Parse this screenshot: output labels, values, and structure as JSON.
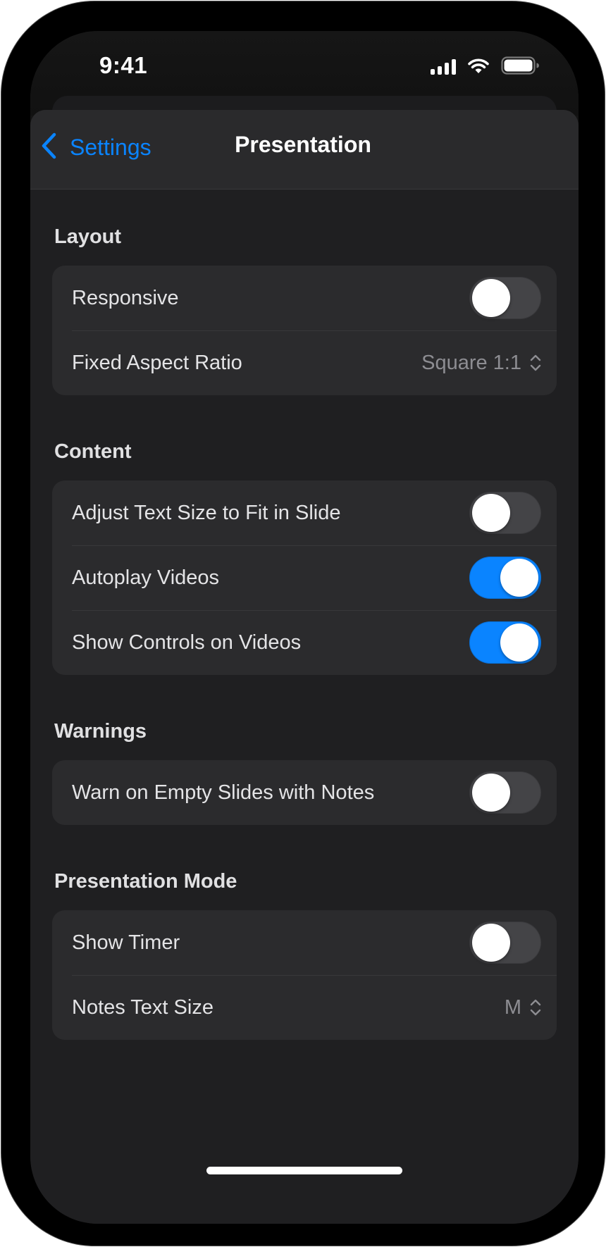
{
  "status_bar": {
    "time": "9:41",
    "icons": [
      "cellular-signal-icon",
      "wifi-icon",
      "battery-icon"
    ]
  },
  "nav": {
    "back_label": "Settings",
    "back_icon": "chevron-left-icon",
    "title": "Presentation"
  },
  "colors": {
    "accent": "#0a84ff",
    "background": "#1f1f21",
    "group_background": "#2b2b2d",
    "toggle_off": "#444447"
  },
  "sections": [
    {
      "header": "Layout",
      "rows": [
        {
          "label": "Responsive",
          "type": "toggle",
          "on": false
        },
        {
          "label": "Fixed Aspect Ratio",
          "type": "picker",
          "value": "Square 1:1"
        }
      ]
    },
    {
      "header": "Content",
      "rows": [
        {
          "label": "Adjust Text Size to Fit in Slide",
          "type": "toggle",
          "on": false
        },
        {
          "label": "Autoplay Videos",
          "type": "toggle",
          "on": true
        },
        {
          "label": "Show Controls on Videos",
          "type": "toggle",
          "on": true
        }
      ]
    },
    {
      "header": "Warnings",
      "rows": [
        {
          "label": "Warn on Empty Slides with Notes",
          "type": "toggle",
          "on": false
        }
      ]
    },
    {
      "header": "Presentation Mode",
      "rows": [
        {
          "label": "Show Timer",
          "type": "toggle",
          "on": false
        },
        {
          "label": "Notes Text Size",
          "type": "picker",
          "value": "M"
        }
      ]
    }
  ]
}
